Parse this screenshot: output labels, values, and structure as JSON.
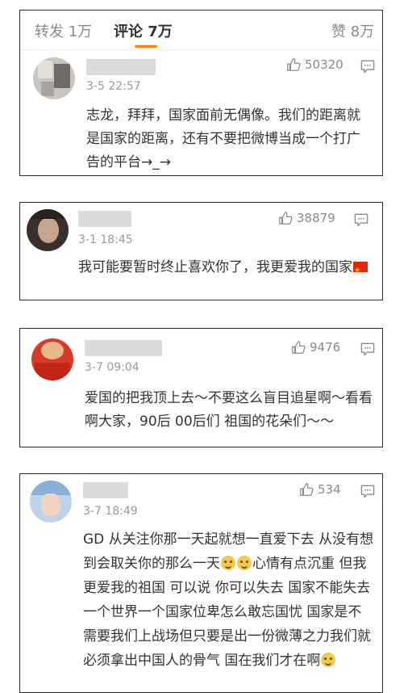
{
  "tabs": {
    "repost": "转发 1万",
    "comments": "评论 7万",
    "likes": "赞 8万"
  },
  "comments": [
    {
      "time": "3-5 22:57",
      "likes": "50320",
      "text": "志龙，拜拜，国家面前无偶像。我们的距离就是国家的距离，还有不要把微博当成一个打广告的平台→_→"
    },
    {
      "time": "3-1 18:45",
      "likes": "38879",
      "text": "我可能要暂时终止喜欢你了，我更爱我的国家"
    },
    {
      "time": "3-7 09:04",
      "likes": "9476",
      "text": "爱国的把我顶上去～不要这么盲目追星啊～看看啊大家，90后 00后们 祖国的花朵们～～"
    },
    {
      "time": "3-7 18:49",
      "likes": "534",
      "text_parts": [
        "GD 从关注你那一天起就想一直爱下去 从没有想到会取关你的那么一天",
        "心情有点沉重 但我更爱我的祖国 可以说 你可以失去 国家不能失去 一个世界一个国家位卑怎么敢忘国忧 国家是不需要我们上战场但只要是出一份微薄之力我们就必须拿出中国人的骨气 国在我们才在啊"
      ]
    }
  ],
  "colors": {
    "accent": "#ff8200",
    "border": "#2a2a2a",
    "muted": "#9a9a9a"
  },
  "icons": [
    "thumbs-up-icon",
    "comment-icon",
    "china-flag-emoji",
    "smile-emoji"
  ]
}
